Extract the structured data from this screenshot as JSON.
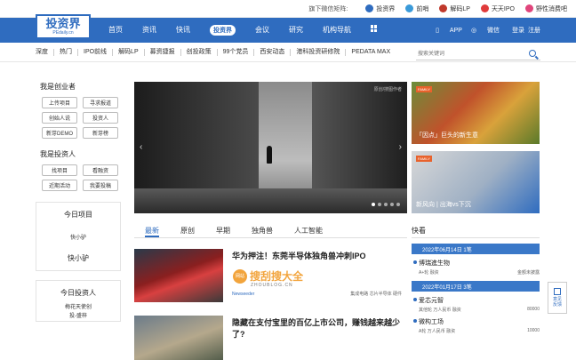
{
  "topbar": {
    "matrix_label": "旗下微信矩阵:",
    "links": [
      {
        "label": "投资界",
        "color": "#2f6cbf"
      },
      {
        "label": "前哨",
        "color": "#3a9ad9"
      },
      {
        "label": "解码LP",
        "color": "#c0392b"
      },
      {
        "label": "天天IPO",
        "color": "#e03b3b"
      },
      {
        "label": "野性消费吧",
        "color": "#e0457b"
      }
    ]
  },
  "nav": {
    "logo_text": "投资界",
    "logo_sub": "PEdaily.cn",
    "items": [
      "首页",
      "资讯",
      "快讯",
      "投资界",
      "会议",
      "研究",
      "机构导航"
    ],
    "right": [
      "APP",
      "微信",
      "登录",
      "注册"
    ]
  },
  "subnav": {
    "items": [
      "深度",
      "热门",
      "IPO前线",
      "解码LP",
      "募资捷报",
      "创投政策",
      "99个党员",
      "西安动态",
      "港科投资研修院",
      "PEDATA MAX"
    ],
    "search_placeholder": "搜索关键词"
  },
  "sidebar": {
    "founder_title": "我是创业者",
    "founder_buttons": [
      "上传项目",
      "寻求报道",
      "创始人说",
      "投资人",
      "新芽DEMO",
      "新芽榜"
    ],
    "investor_title": "我是投资人",
    "investor_buttons": [
      "找项目",
      "看融资",
      "近期活动",
      "我要投稿"
    ],
    "today_project_title": "今日项目",
    "today_project_logo": "快小驴",
    "today_project_name": "快小驴",
    "today_investor_title": "今日投资人",
    "today_investor_names": [
      "梅花天使创",
      "投-盛梓"
    ]
  },
  "hero": {
    "caption": "原创/搜图作者"
  },
  "thumbs": [
    {
      "tag": "FAMILY",
      "title": "「因点」巨头的新生意"
    },
    {
      "tag": "FAMILY",
      "title": "新风向 | 出海vs下沉"
    }
  ],
  "tabs": [
    "最新",
    "原创",
    "早期",
    "独角兽",
    "人工智能"
  ],
  "articles": [
    {
      "title": "华为押注！东莞半导体独角兽冲刺IPO",
      "meta": "Newseeder",
      "tags": "集成电路  芯片半导体  硬件"
    },
    {
      "title": "隐藏在支付宝里的百亿上市公司，赚钱越来越少了?",
      "meta": "",
      "tags": ""
    }
  ],
  "flash": {
    "title": "快看",
    "groups": [
      {
        "date": "2022年06月14日 1笔",
        "items": [
          {
            "name": "博瑞進生物",
            "round": "A+轮  融资",
            "amount": "金额未披露"
          }
        ]
      },
      {
        "date": "2022年01月17日 3笔",
        "items": [
          {
            "name": "爱芯元智",
            "round": "其他轮  万人民币  融资",
            "amount": "80000"
          },
          {
            "name": "微构工场",
            "round": "A轮  万人民币  融资",
            "amount": "10000"
          }
        ]
      }
    ]
  },
  "float": {
    "label1": "意见",
    "label2": "反馈"
  },
  "watermark": {
    "circle": "网站",
    "title": "搜刮搜大全",
    "sub": "ZHOUBLOG.CN"
  }
}
